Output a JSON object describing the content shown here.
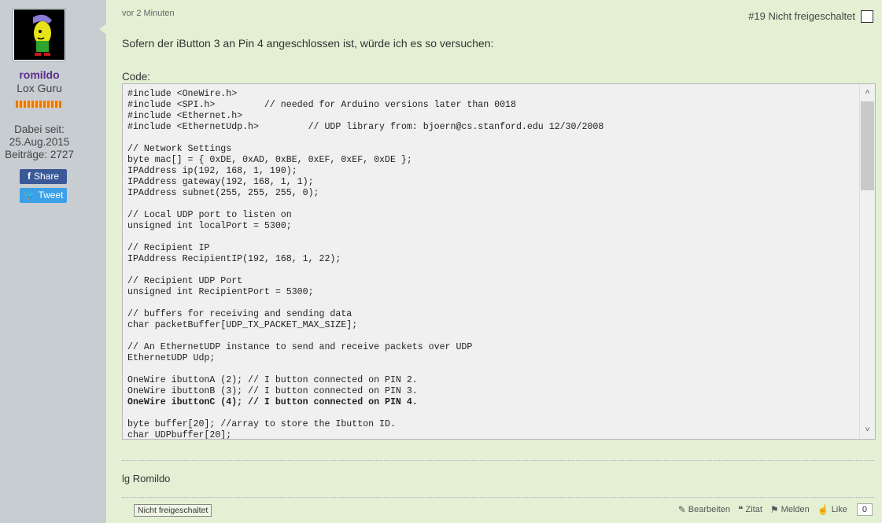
{
  "sidebar": {
    "username": "romildo",
    "user_title": "Lox Guru",
    "member_since_label": "Dabei seit:",
    "member_since_date": "25.Aug.2015",
    "posts": "Beiträge: 2727",
    "share_label": "Share",
    "tweet_label": "Tweet"
  },
  "post": {
    "timestamp": "vor 2 Minuten",
    "number": "#19 Nicht freigeschaltet",
    "text": "Sofern der iButton 3 an Pin 4 angeschlossen ist, würde ich es so versuchen:",
    "code_label": "Code:",
    "code_lines": [
      "#include <OneWire.h>",
      "#include <SPI.h>         // needed for Arduino versions later than 0018",
      "#include <Ethernet.h>",
      "#include <EthernetUdp.h>         // UDP library from: bjoern@cs.stanford.edu 12/30/2008",
      "",
      "// Network Settings",
      "byte mac[] = { 0xDE, 0xAD, 0xBE, 0xEF, 0xEF, 0xDE };",
      "IPAddress ip(192, 168, 1, 190);",
      "IPAddress gateway(192, 168, 1, 1);",
      "IPAddress subnet(255, 255, 255, 0);",
      "",
      "// Local UDP port to listen on",
      "unsigned int localPort = 5300;",
      "",
      "// Recipient IP",
      "IPAddress RecipientIP(192, 168, 1, 22);",
      "",
      "// Recipient UDP Port",
      "unsigned int RecipientPort = 5300;",
      "",
      "// buffers for receiving and sending data",
      "char packetBuffer[UDP_TX_PACKET_MAX_SIZE];",
      "",
      "// An EthernetUDP instance to send and receive packets over UDP",
      "EthernetUDP Udp;",
      "",
      "OneWire ibuttonA (2); // I button connected on PIN 2.",
      "OneWire ibuttonB (3); // I button connected on PIN 3.",
      "OneWire ibuttonC (4); // I button connected on PIN 4.",
      "",
      "byte buffer[20]; //array to store the Ibutton ID.",
      "char UDPbuffer[20];"
    ],
    "bold_line_index": 28,
    "signature": "lg Romildo",
    "status_tag": "Nicht freigeschaltet",
    "actions": {
      "edit": "Bearbeiten",
      "quote": "Zitat",
      "report": "Melden",
      "like": "Like",
      "like_count": "0"
    }
  },
  "colors": {
    "sidebar_bg": "#c8cdd2",
    "post_bg": "#e4f0d4",
    "username": "#5b2d8c",
    "facebook": "#3b5998",
    "twitter": "#3aa0e8",
    "rank": "#e07a10"
  },
  "icons": {
    "edit": "pencil-icon",
    "quote": "quote-icon",
    "report": "flag-icon",
    "like": "thumbs-up-icon",
    "facebook": "facebook-icon",
    "twitter": "twitter-icon"
  }
}
